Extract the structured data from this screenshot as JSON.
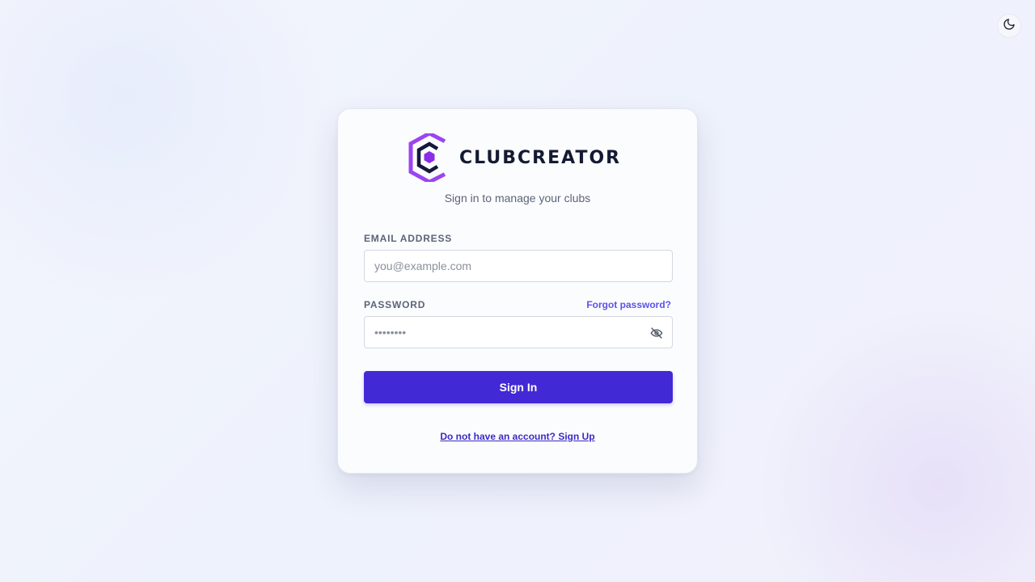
{
  "header": {
    "theme_toggle_icon": "moon-icon"
  },
  "brand": {
    "name": "CLUBCREATOR",
    "logo_icon": "clubcreator-hexagon-logo",
    "colors": {
      "logo_outer": "#9b44f0",
      "logo_inner": "#14183a",
      "logo_core": "#8a2ce8"
    }
  },
  "login": {
    "subtitle": "Sign in to manage your clubs",
    "email": {
      "label": "EMAIL ADDRESS",
      "placeholder": "you@example.com",
      "value": ""
    },
    "password": {
      "label": "PASSWORD",
      "placeholder": "••••••••",
      "value": "",
      "visibility_icon": "eye-off-icon"
    },
    "forgot_label": "Forgot password?",
    "submit_label": "Sign In",
    "signup_label": "Do not have an account? Sign Up"
  },
  "colors": {
    "primary": "#4229d6",
    "link": "#5b52e8",
    "text_muted": "#5b6478",
    "text_dark": "#141a33"
  }
}
